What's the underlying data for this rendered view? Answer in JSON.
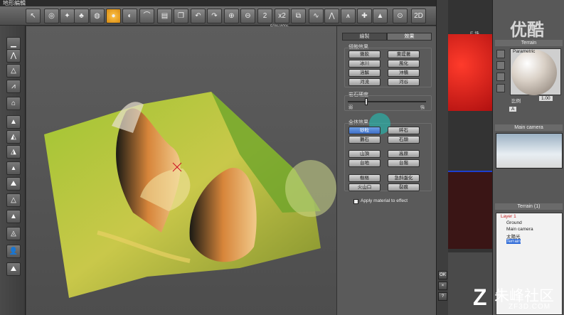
{
  "window": {
    "title": "地形編輯"
  },
  "toolbar": {
    "zoom_label": "50%/40%",
    "buttons": [
      "",
      "",
      "",
      "",
      "",
      "",
      "",
      "",
      "",
      "",
      "",
      "",
      "",
      "",
      "2",
      "x2",
      "",
      "",
      "",
      "",
      "",
      "",
      "",
      "",
      ""
    ]
  },
  "panel": {
    "tabs": [
      "繪製",
      "效果"
    ],
    "erosion": {
      "title": "侵蝕效果",
      "buttons": [
        "黴飲",
        "東堤著",
        "冰川",
        "風化",
        "溶解",
        "沖積",
        "河流",
        "河谷"
      ]
    },
    "rock_hardness": {
      "title": "岩石硬度",
      "min_label": "弱",
      "max_label": "強"
    },
    "global": {
      "title": "全体效果",
      "buttons": [
        "砂粒",
        "碎石",
        "鵝石",
        "石頭",
        "山頂",
        "高原",
        "台地",
        "台階",
        "樞樞",
        "急斜蛋化",
        "火山口",
        "裂痕"
      ]
    },
    "apply_material_label": "Apply material to effect"
  },
  "side_strip": {
    "ok": "OK",
    "cancel": "×",
    "help": "?"
  },
  "right": {
    "material_header": "Terrain",
    "material_name": "Parametric",
    "scale_label": "比例",
    "scale_value": "1.00",
    "channel": "A",
    "camera_header": "Main camera",
    "tree_header": "Terrain (1)",
    "tree": [
      "Layer 1",
      "Ground",
      "Main camera",
      "太陽光",
      "Terrain"
    ],
    "bg_tab_label": "E 场"
  },
  "watermarks": {
    "top": "优酷",
    "brand": "朱峰社区",
    "url": "ZF3D.COM"
  }
}
